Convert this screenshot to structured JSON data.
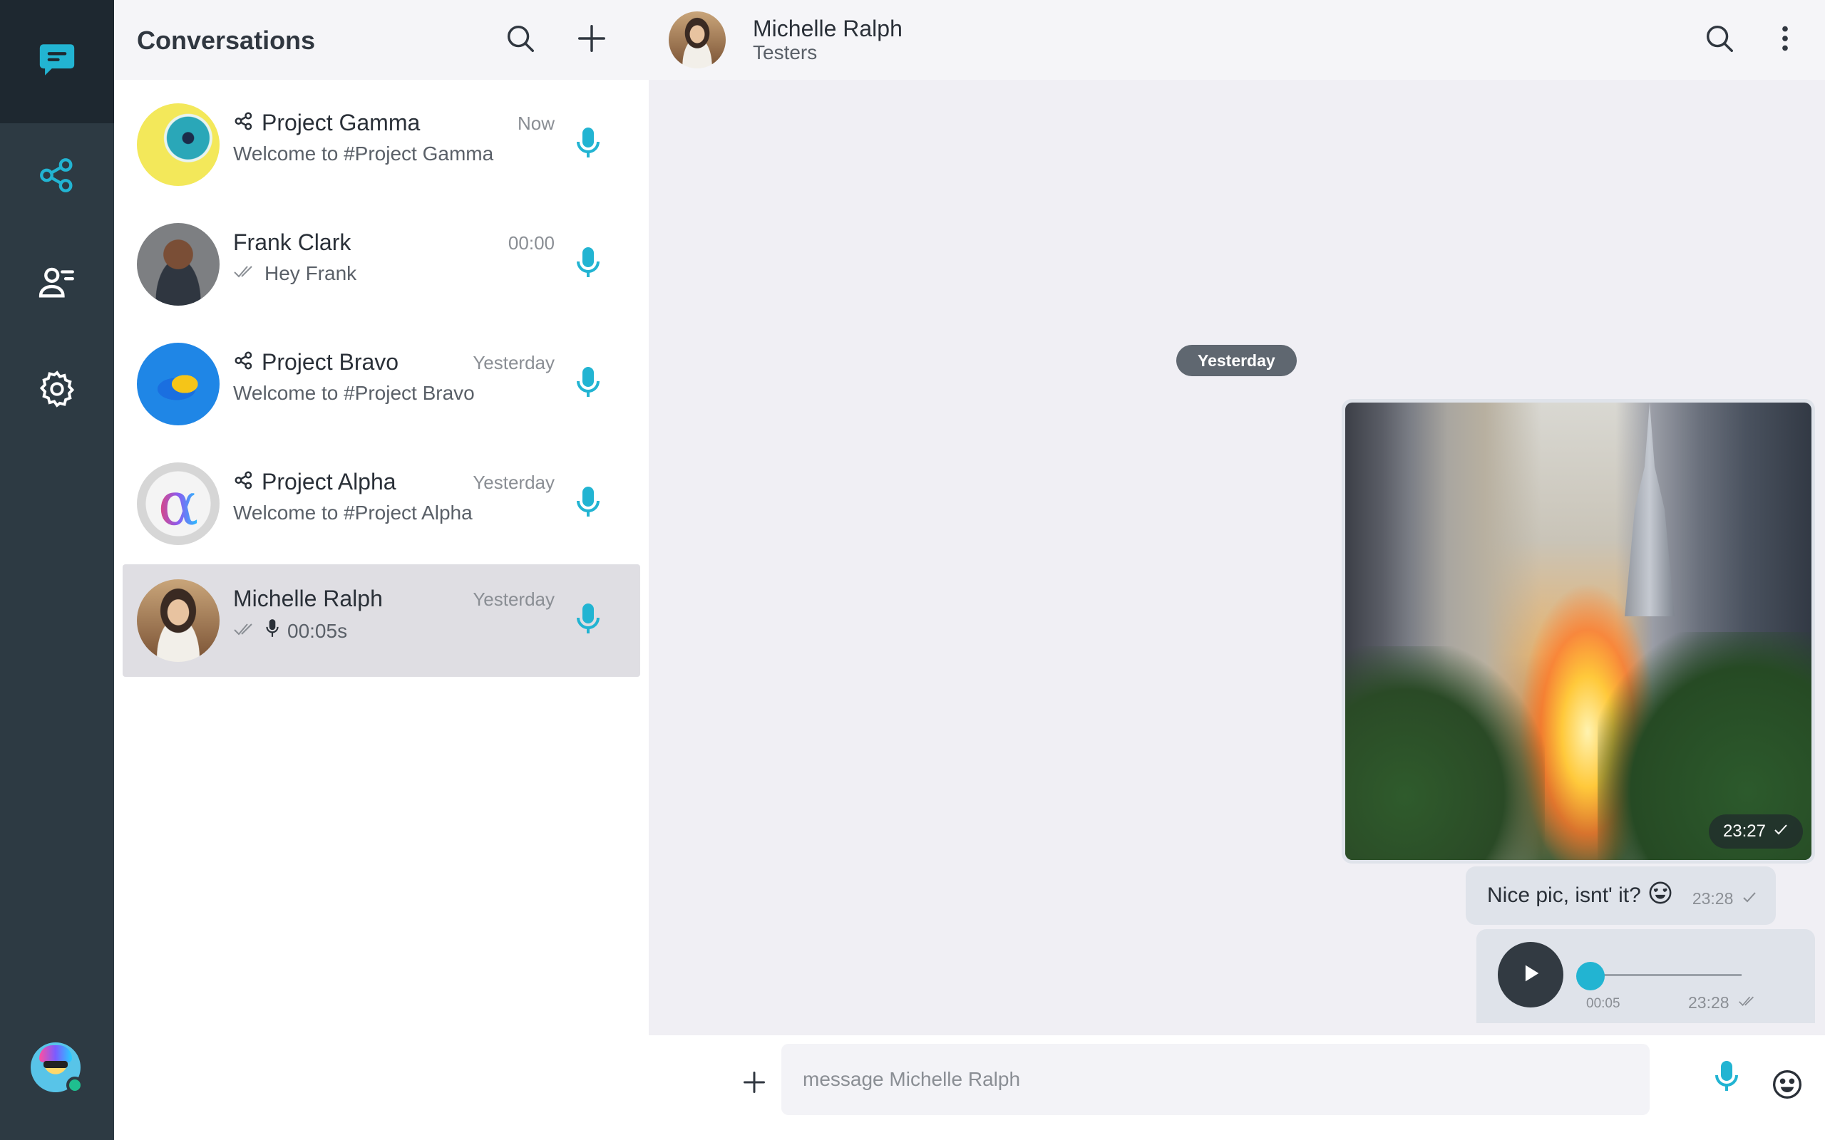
{
  "colors": {
    "accent": "#22b4d2",
    "rail": "#2d3a43",
    "rail_active": "#1e2830",
    "bubble": "#dfe3ea"
  },
  "rail": {
    "items": [
      {
        "icon": "chat-bubble-icon",
        "active": true
      },
      {
        "icon": "share-nodes-icon",
        "active": false
      },
      {
        "icon": "user-list-icon",
        "active": false
      },
      {
        "icon": "gear-icon",
        "active": false
      }
    ],
    "user_status": "online"
  },
  "list": {
    "title": "Conversations",
    "conversations": [
      {
        "name": "Project Gamma",
        "group": true,
        "time": "Now",
        "preview": "Welcome to #Project Gamma",
        "ticks": false,
        "voice": false,
        "selected": false
      },
      {
        "name": "Frank Clark",
        "group": false,
        "time": "00:00",
        "preview": "Hey Frank",
        "ticks": true,
        "voice": false,
        "selected": false
      },
      {
        "name": "Project Bravo",
        "group": true,
        "time": "Yesterday",
        "preview": "Welcome to #Project Bravo",
        "ticks": false,
        "voice": false,
        "selected": false
      },
      {
        "name": "Project Alpha",
        "group": true,
        "time": "Yesterday",
        "preview": "Welcome to #Project Alpha",
        "ticks": false,
        "voice": false,
        "selected": false
      },
      {
        "name": "Michelle Ralph",
        "group": false,
        "time": "Yesterday",
        "preview": "00:05s",
        "ticks": true,
        "voice": true,
        "selected": true
      }
    ]
  },
  "chat": {
    "name": "Michelle Ralph",
    "subtitle": "Testers",
    "date_chip": "Yesterday",
    "image_message": {
      "time": "23:27"
    },
    "text_message": {
      "text": "Nice pic, isnt' it?",
      "time": "23:28"
    },
    "audio_message": {
      "duration": "00:05",
      "time": "23:28",
      "progress": 0
    },
    "composer": {
      "placeholder": "message Michelle Ralph",
      "value": ""
    }
  }
}
